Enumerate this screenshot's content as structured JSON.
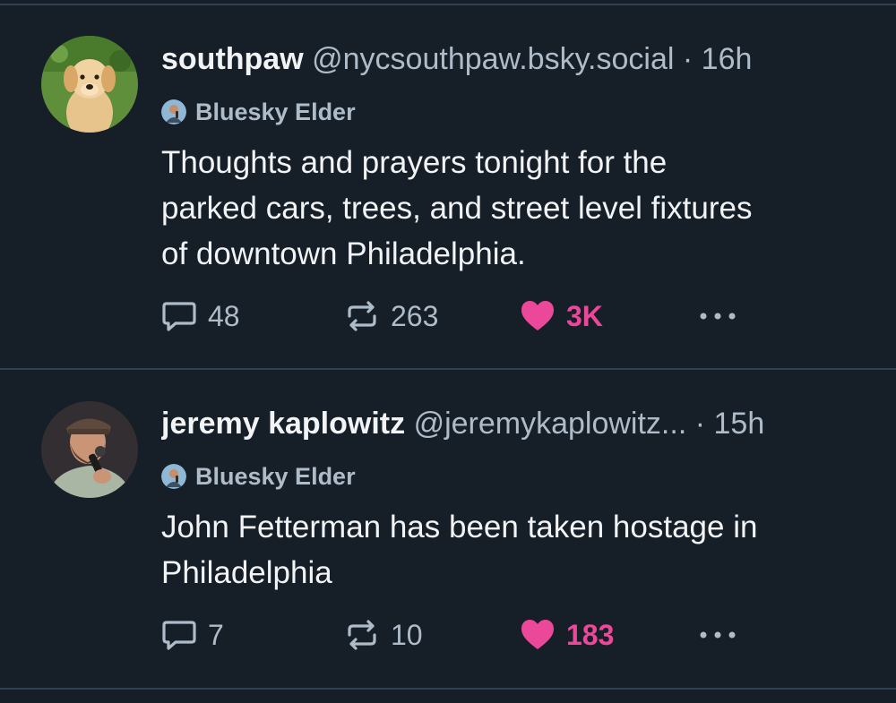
{
  "posts": [
    {
      "author": {
        "display_name": "southpaw",
        "handle": "@nycsouthpaw.bsky.social",
        "separator": "·",
        "time": "16h",
        "avatar_icon": "golden-retriever-puppy-avatar"
      },
      "badge": {
        "label": "Bluesky Elder",
        "icon": "bluesky-elder-badge-icon"
      },
      "lines": [
        "Thoughts and prayers tonight for the",
        "parked cars, trees, and street level fixtures",
        "of downtown Philadelphia."
      ],
      "actions": {
        "replies": "48",
        "reposts": "263",
        "likes": "3K",
        "liked": true
      }
    },
    {
      "author": {
        "display_name": "jeremy kaplowitz",
        "handle": "@jeremykaplowitz...",
        "separator": "·",
        "time": "15h",
        "avatar_icon": "man-with-microphone-avatar"
      },
      "badge": {
        "label": "Bluesky Elder",
        "icon": "bluesky-elder-badge-icon"
      },
      "lines": [
        "John Fetterman has been taken hostage in",
        "Philadelphia"
      ],
      "actions": {
        "replies": "7",
        "reposts": "10",
        "likes": "183",
        "liked": true
      }
    }
  ],
  "colors": {
    "background": "#161e27",
    "divider": "#2e4052",
    "text_primary": "#f1f3f5",
    "text_secondary": "#aebbc9",
    "like_pink": "#ec4899"
  }
}
